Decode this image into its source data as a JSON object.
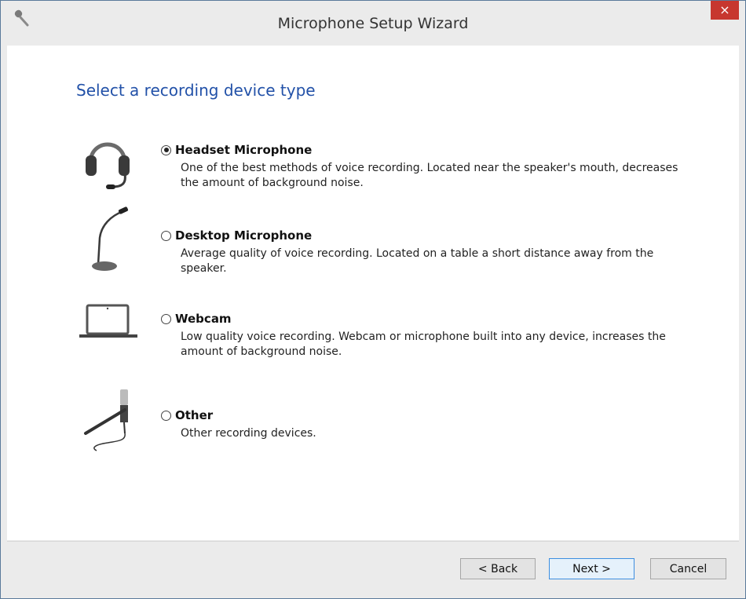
{
  "window": {
    "title": "Microphone Setup Wizard",
    "close_glyph": "×",
    "app_icon": "microphone-icon"
  },
  "main": {
    "heading": "Select a recording device type",
    "options": [
      {
        "label": "Headset Microphone",
        "description": "One of the best methods of voice recording. Located near the speaker's mouth, decreases the amount of background noise.",
        "icon": "headset-icon",
        "selected": true
      },
      {
        "label": "Desktop Microphone",
        "description": "Average quality of voice recording. Located on a table a short distance away from the speaker.",
        "icon": "desktop-microphone-icon",
        "selected": false
      },
      {
        "label": "Webcam",
        "description": "Low quality voice recording. Webcam or microphone built into any device, increases the amount of background noise.",
        "icon": "laptop-webcam-icon",
        "selected": false
      },
      {
        "label": "Other",
        "description": "Other recording devices.",
        "icon": "studio-microphone-icon",
        "selected": false
      }
    ]
  },
  "footer": {
    "back_label": "< Back",
    "next_label": "Next >",
    "cancel_label": "Cancel"
  },
  "colors": {
    "heading": "#2251a8",
    "close_button": "#c7372f",
    "default_button_border": "#3d8ee0"
  }
}
